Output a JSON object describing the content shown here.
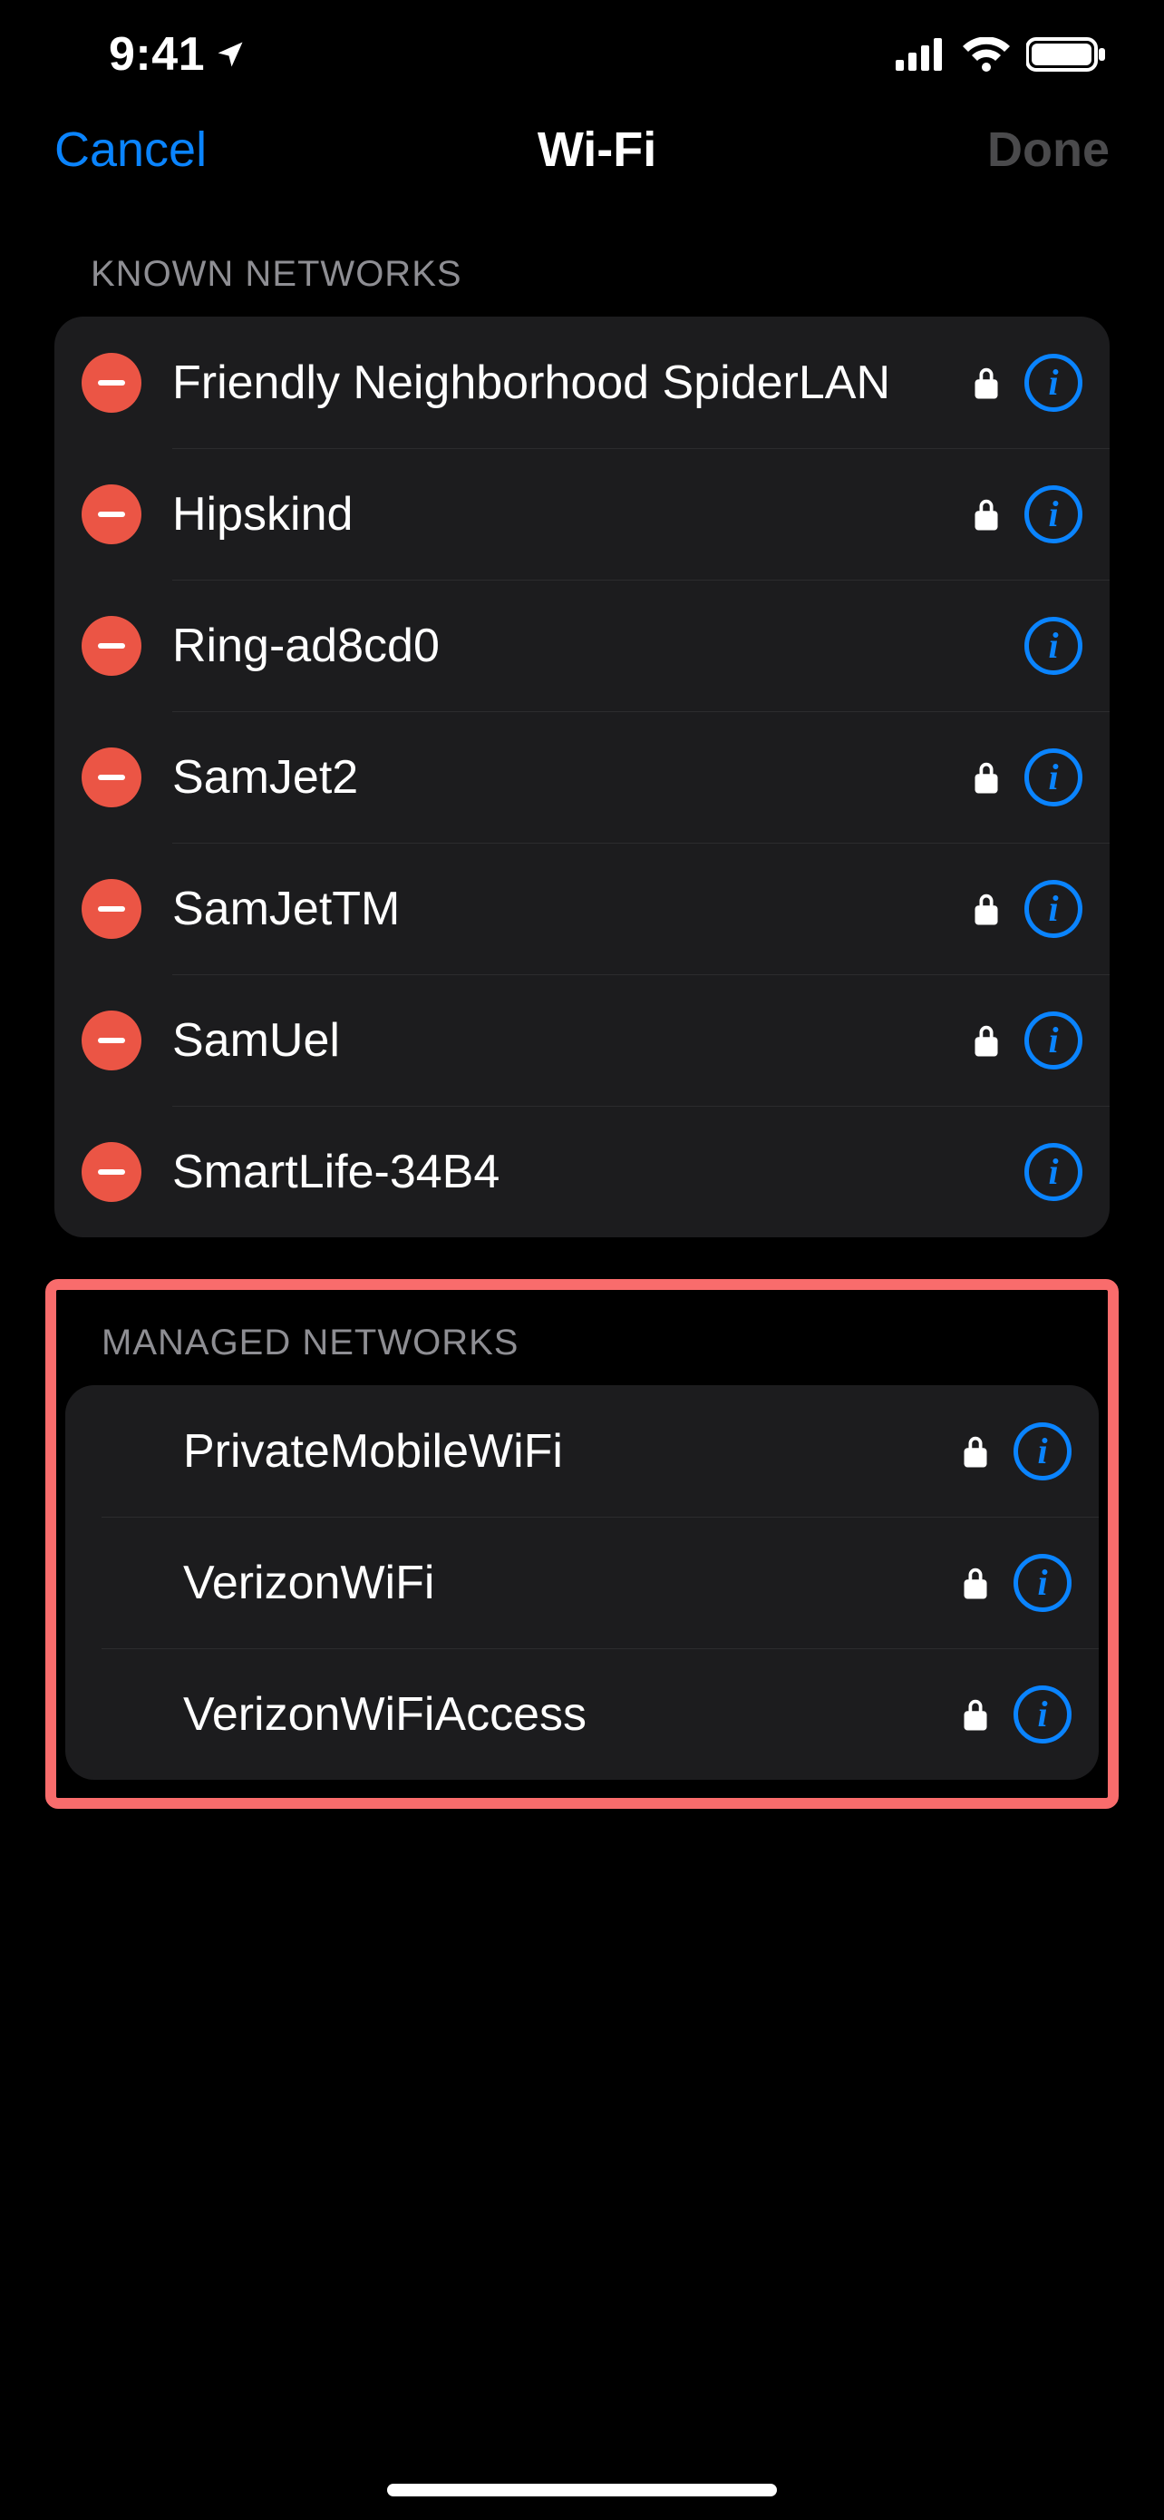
{
  "status": {
    "time": "9:41"
  },
  "nav": {
    "cancel": "Cancel",
    "title": "Wi-Fi",
    "done": "Done"
  },
  "sections": {
    "known": {
      "header": "KNOWN NETWORKS",
      "networks": [
        {
          "name": "Friendly Neighborhood SpiderLAN",
          "locked": true
        },
        {
          "name": "Hipskind",
          "locked": true
        },
        {
          "name": "Ring-ad8cd0",
          "locked": false
        },
        {
          "name": "SamJet2",
          "locked": true
        },
        {
          "name": "SamJetTM",
          "locked": true
        },
        {
          "name": "SamUel",
          "locked": true
        },
        {
          "name": "SmartLife-34B4",
          "locked": false
        }
      ]
    },
    "managed": {
      "header": "MANAGED NETWORKS",
      "networks": [
        {
          "name": "PrivateMobileWiFi",
          "locked": true
        },
        {
          "name": "VerizonWiFi",
          "locked": true
        },
        {
          "name": "VerizonWiFiAccess",
          "locked": true
        }
      ]
    }
  },
  "colors": {
    "accent": "#0a84ff",
    "delete": "#eb5545",
    "highlight": "#f96c6c"
  }
}
